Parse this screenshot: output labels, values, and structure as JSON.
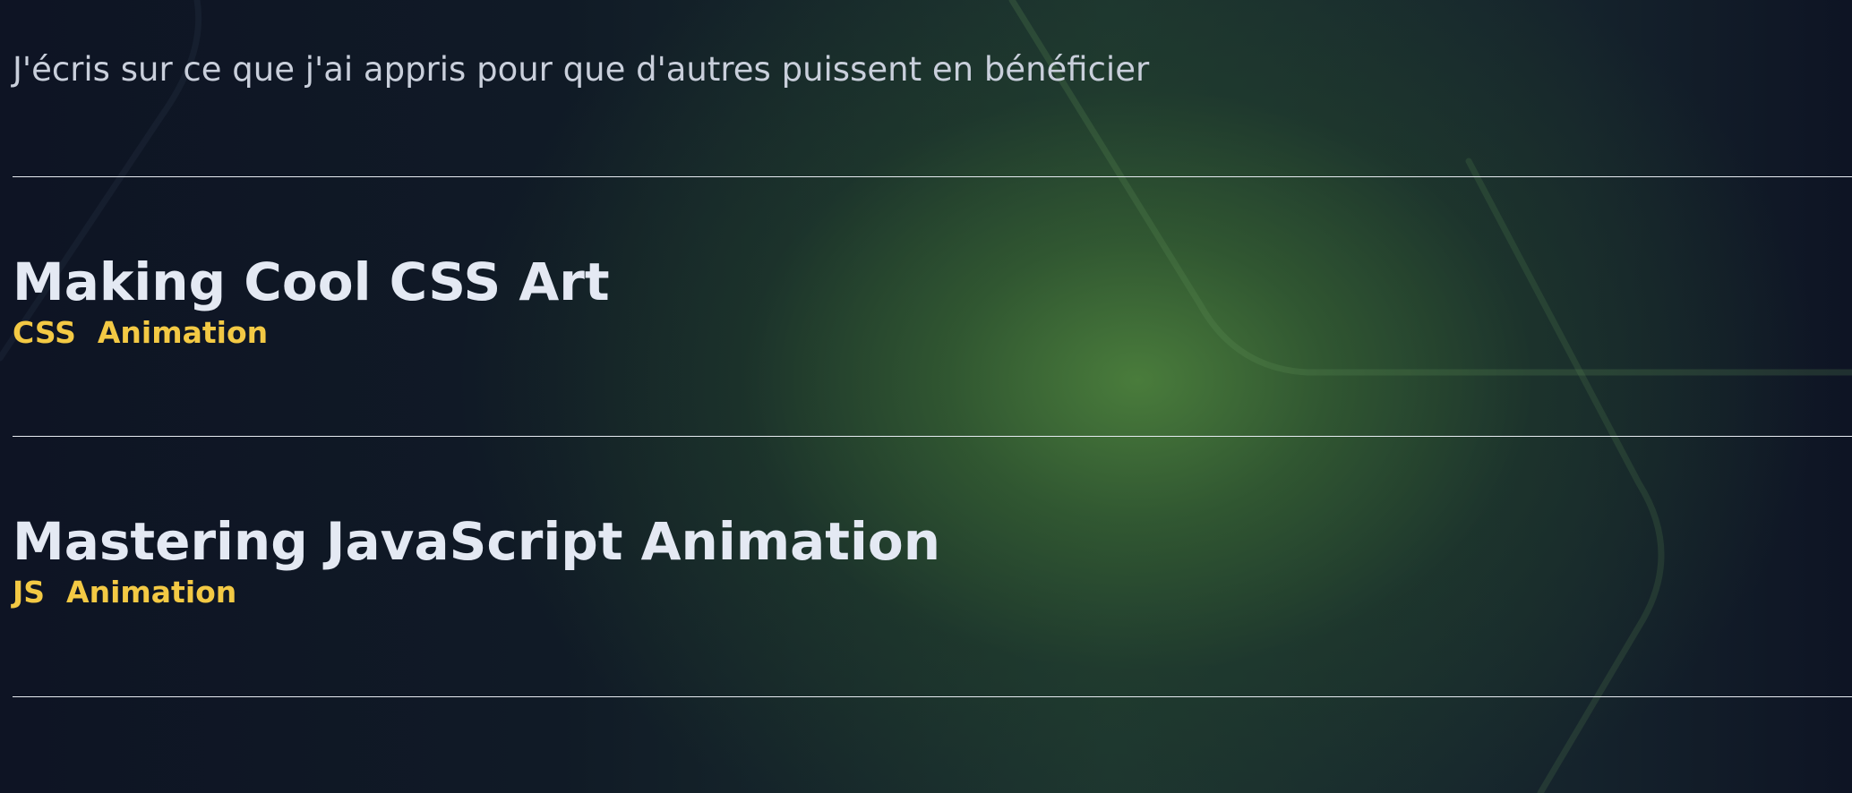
{
  "page": {
    "tagline": "J'écris sur ce que j'ai appris pour que d'autres puissent en bénéficier"
  },
  "posts": [
    {
      "title": "Making Cool CSS Art",
      "tags": [
        "CSS",
        "Animation"
      ]
    },
    {
      "title": "Mastering JavaScript Animation",
      "tags": [
        "JS",
        "Animation"
      ]
    }
  ],
  "colors": {
    "background": "#0e1424",
    "glow": "#4c803c",
    "title": "#e4e9f3",
    "tag": "#f3c944",
    "divider": "#e8ecf2"
  }
}
